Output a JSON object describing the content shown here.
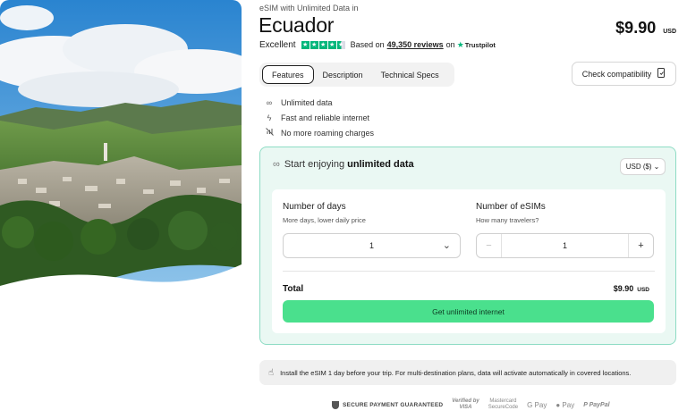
{
  "hero": {
    "alt": "Ecuador landscape"
  },
  "product": {
    "eyebrow": "eSIM with Unlimited Data in",
    "title": "Ecuador",
    "price": "$9.90",
    "currency": "USD"
  },
  "rating": {
    "label": "Excellent",
    "based_on": "Based on",
    "reviews": "49,350 reviews",
    "on": "on",
    "brand": "Trustpilot",
    "stars": 4.5
  },
  "tabs": [
    {
      "label": "Features",
      "active": true
    },
    {
      "label": "Description",
      "active": false
    },
    {
      "label": "Technical Specs",
      "active": false
    }
  ],
  "compat_button": {
    "label": "Check compatibility",
    "icon": "device-check-icon"
  },
  "features": [
    {
      "icon": "infinity-icon",
      "label": "Unlimited data"
    },
    {
      "icon": "bolt-icon",
      "label": "Fast and reliable internet"
    },
    {
      "icon": "no-roaming-icon",
      "label": "No more roaming charges"
    }
  ],
  "plan": {
    "heading_prefix": "Start enjoying",
    "heading_bold": "unlimited data",
    "currency_select": "USD ($)",
    "days_label": "Number of days",
    "days_sub": "More days, lower daily price",
    "days_value": "1",
    "esims_label": "Number of eSIMs",
    "esims_sub": "How many travelers?",
    "esims_value": "1",
    "minus": "−",
    "plus": "+",
    "total_label": "Total",
    "total_value": "$9.90",
    "total_currency": "USD",
    "cta": "Get unlimited internet"
  },
  "notice": {
    "icon": "hand-pointer-icon",
    "text": "Install the eSIM 1 day before your trip. For multi-destination plans, data will activate automatically in covered locations."
  },
  "payments": {
    "secure": "SECURE PAYMENT GUARANTEED",
    "visa_top": "Verified by",
    "visa_bottom": "VISA",
    "mc_top": "Mastercard",
    "mc_bottom": "SecureCode",
    "gpay": "G Pay",
    "applepay": "Pay",
    "paypal": "PayPal"
  },
  "colors": {
    "accent_green": "#4ae08d",
    "trustpilot_green": "#00b67a",
    "plan_bg": "#eaf8f3",
    "plan_border": "#8ddcc4"
  }
}
